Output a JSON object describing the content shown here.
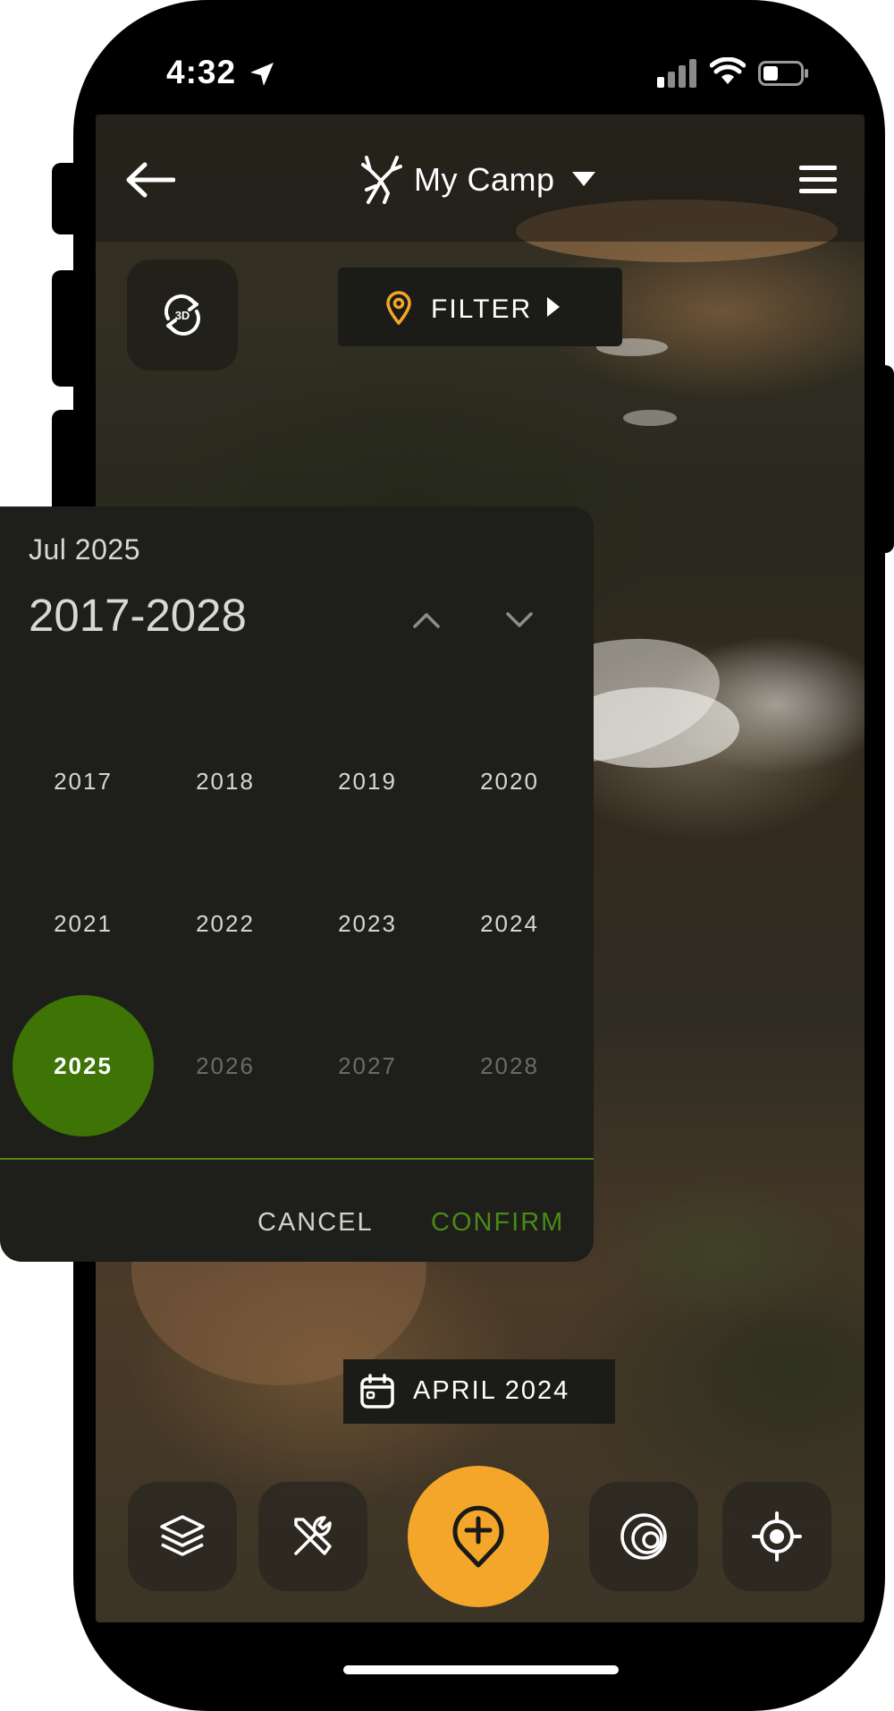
{
  "status_bar": {
    "time": "4:32"
  },
  "header": {
    "title": "My Camp"
  },
  "map_controls": {
    "three_d_label": "3D",
    "filter_label": "FILTER"
  },
  "date_picker": {
    "selected_month": "Jul 2025",
    "range_label": "2017-2028",
    "years": [
      {
        "label": "2017",
        "state": "enabled"
      },
      {
        "label": "2018",
        "state": "enabled"
      },
      {
        "label": "2019",
        "state": "enabled"
      },
      {
        "label": "2020",
        "state": "enabled"
      },
      {
        "label": "2021",
        "state": "enabled"
      },
      {
        "label": "2022",
        "state": "enabled"
      },
      {
        "label": "2023",
        "state": "enabled"
      },
      {
        "label": "2024",
        "state": "enabled"
      },
      {
        "label": "2025",
        "state": "selected"
      },
      {
        "label": "2026",
        "state": "disabled"
      },
      {
        "label": "2027",
        "state": "disabled"
      },
      {
        "label": "2028",
        "state": "disabled"
      }
    ],
    "cancel_label": "CANCEL",
    "confirm_label": "CONFIRM"
  },
  "imagery_date": {
    "label": "APRIL 2024"
  },
  "bottom_toolbar": {
    "items": [
      "layers-icon",
      "tools-icon",
      "add-pin-icon",
      "range-rings-icon",
      "locate-icon"
    ]
  },
  "colors": {
    "accent_orange": "#f4a62a",
    "selected_green": "#3e7306",
    "confirm_green": "#4b8a16",
    "panel_bg": "#1e1e1b"
  }
}
